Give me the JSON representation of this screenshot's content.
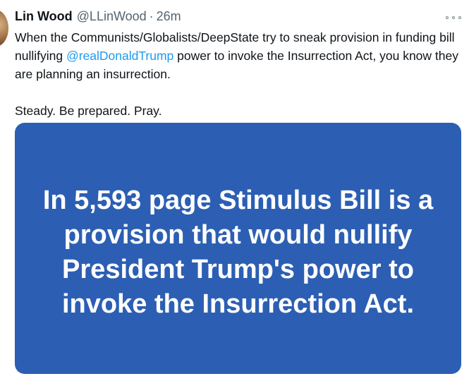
{
  "tweet": {
    "author_name": "Lin Wood",
    "author_handle": "@LLinWood",
    "separator": "·",
    "timestamp": "26m",
    "body_before_mention": "When the Communists/Globalists/DeepState try to sneak provision in funding bill nullifying ",
    "mention": "@realDonaldTrump",
    "body_after_mention": " power to invoke the Insurrection Act, you know they are planning an insurrection.",
    "second_paragraph": "Steady. Be prepared. Pray.",
    "more_icon": "more-horizontal-icon"
  },
  "media": {
    "image_text": "In 5,593 page Stimulus Bill is a provision that would nullify President Trump's power to invoke the Insurrection Act.",
    "background_color": "#2c5fb3",
    "text_color": "#ffffff"
  },
  "colors": {
    "link": "#1d9bf0",
    "secondary_text": "#536471",
    "primary_text": "#0f1419"
  }
}
